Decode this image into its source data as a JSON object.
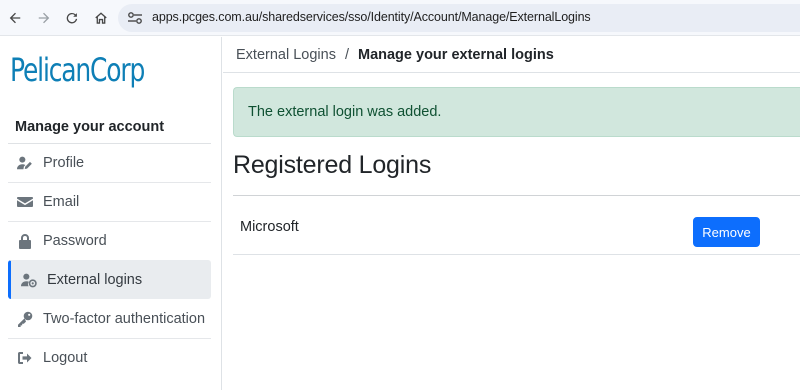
{
  "browser": {
    "url": "apps.pcges.com.au/sharedservices/sso/Identity/Account/Manage/ExternalLogins",
    "icons": [
      "back-arrow-icon",
      "forward-arrow-icon",
      "reload-icon",
      "home-icon",
      "site-info-icon"
    ]
  },
  "brand": {
    "logo_text": "PelicanCorp",
    "logo_color": "#0e7fb6"
  },
  "sidebar": {
    "heading": "Manage your account",
    "items": [
      {
        "label": "Profile",
        "icon": "user-pen-icon",
        "active": false
      },
      {
        "label": "Email",
        "icon": "envelope-icon",
        "active": false
      },
      {
        "label": "Password",
        "icon": "lock-icon",
        "active": false
      },
      {
        "label": "External logins",
        "icon": "user-gear-icon",
        "active": true
      },
      {
        "label": "Two-factor authentication",
        "icon": "key-icon",
        "active": false
      },
      {
        "label": "Logout",
        "icon": "sign-out-icon",
        "active": false
      }
    ]
  },
  "breadcrumb": {
    "parent": "External Logins",
    "separator": "/",
    "current": "Manage your external logins"
  },
  "alert": {
    "message": "The external login was added.",
    "type": "success"
  },
  "main": {
    "section_title": "Registered Logins",
    "logins": [
      {
        "provider": "Microsoft",
        "action_label": "Remove"
      }
    ]
  },
  "colors": {
    "accent": "#0d6efd",
    "alert_bg": "#d1e7dd",
    "alert_text": "#0f5132"
  }
}
